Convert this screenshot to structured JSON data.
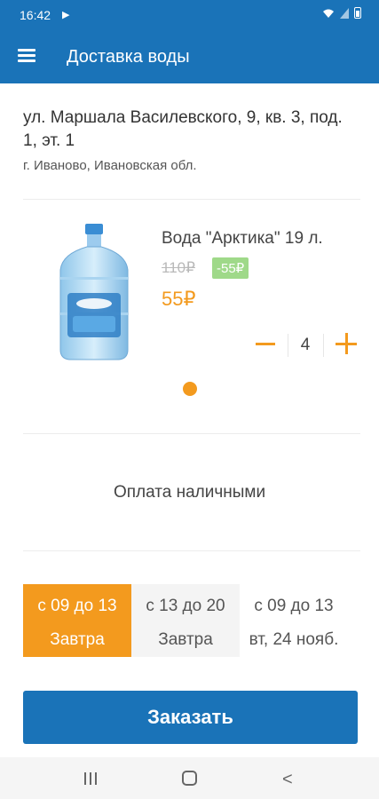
{
  "status_bar": {
    "time": "16:42"
  },
  "app_bar": {
    "title": "Доставка воды"
  },
  "address": {
    "line1": "ул. Маршала Василевского, 9, кв. 3, под. 1, эт. 1",
    "line2": "г. Иваново, Ивановская обл."
  },
  "product": {
    "name": "Вода \"Арктика\" 19 л.",
    "old_price": "110₽",
    "discount": "-55₽",
    "price": "55₽",
    "quantity": "4"
  },
  "payment": {
    "label": "Оплата наличными"
  },
  "delivery_slots": [
    {
      "time": "с 09 до 13",
      "day": "Завтра",
      "selected": true
    },
    {
      "time": "с 13 до 20",
      "day": "Завтра",
      "selected": false
    },
    {
      "time": "с 09 до 13",
      "day": "вт, 24 нояб.",
      "selected": false
    }
  ],
  "order_button": {
    "label": "Заказать"
  },
  "colors": {
    "primary": "#1a73b8",
    "accent": "#f39a1e",
    "discount_badge": "#9fd989"
  },
  "icons": [
    "menu-icon",
    "wifi-icon",
    "signal-icon",
    "battery-icon",
    "minus-icon",
    "plus-icon",
    "recent-apps-icon",
    "home-icon",
    "back-icon"
  ]
}
